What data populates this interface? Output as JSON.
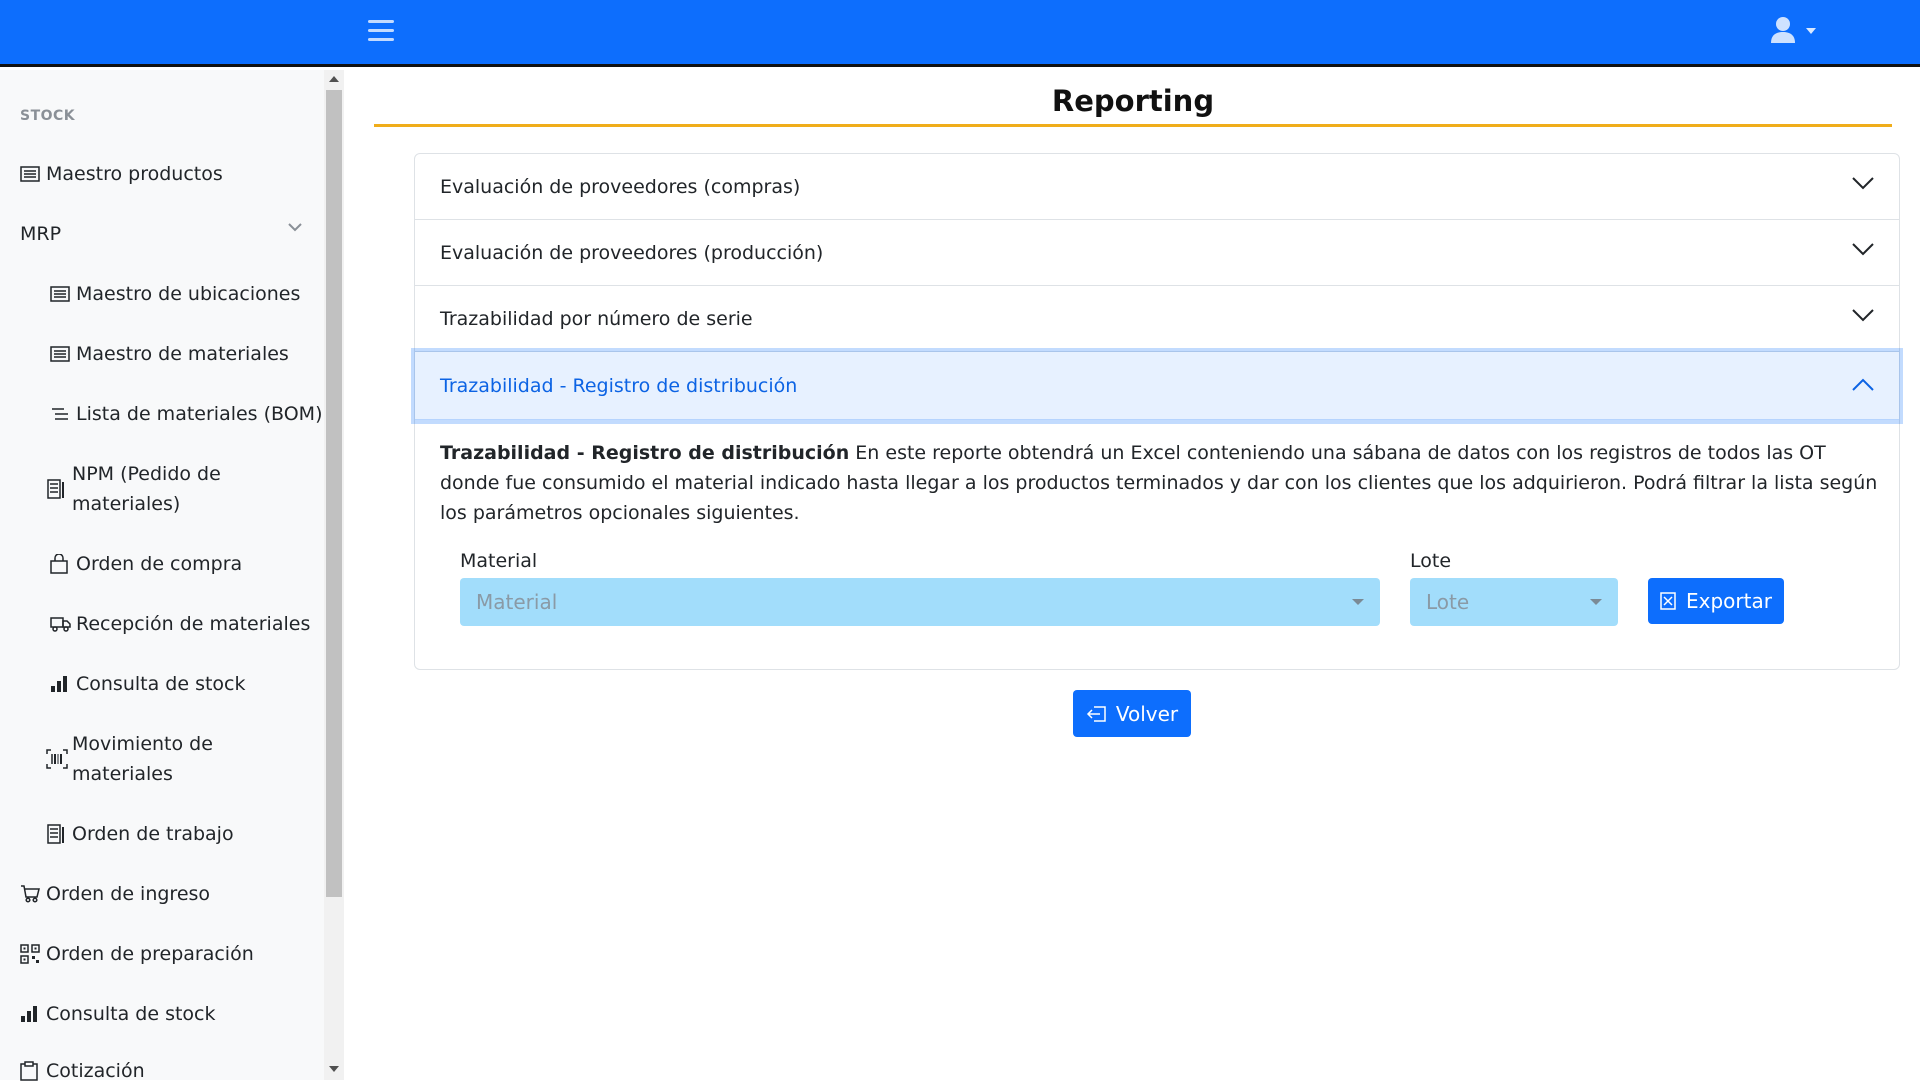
{
  "navbar": {
    "menu_icon": "hamburger-icon",
    "user_icon": "user-icon"
  },
  "sidebar": {
    "section_heading": "STOCK",
    "items": [
      {
        "label": "Maestro productos",
        "icon": "list-icon"
      },
      {
        "label": "MRP",
        "icon": "chevron-down-icon"
      },
      {
        "label": "Maestro de ubicaciones",
        "icon": "list-icon"
      },
      {
        "label": "Maestro de materiales",
        "icon": "list-icon"
      },
      {
        "label": "Lista de materiales (BOM)",
        "icon": "text-lines-icon"
      },
      {
        "label": "NPM (Pedido de materiales)",
        "icon": "document-icon"
      },
      {
        "label": "Orden de compra",
        "icon": "bag-icon"
      },
      {
        "label": "Recepción de materiales",
        "icon": "truck-icon"
      },
      {
        "label": "Consulta de stock",
        "icon": "bar-chart-icon"
      },
      {
        "label": "Movimiento de materiales",
        "icon": "barcode-icon"
      },
      {
        "label": "Orden de trabajo",
        "icon": "document-icon"
      },
      {
        "label": "Orden de ingreso",
        "icon": "cart-icon"
      },
      {
        "label": "Orden de preparación",
        "icon": "qr-icon"
      },
      {
        "label": "Consulta de stock",
        "icon": "bar-chart-icon"
      },
      {
        "label": "Cotización",
        "icon": "clipboard-icon"
      }
    ]
  },
  "main": {
    "title": "Reporting",
    "accordion": [
      {
        "label": "Evaluación de proveedores (compras)",
        "expanded": false
      },
      {
        "label": "Evaluación de proveedores (producción)",
        "expanded": false
      },
      {
        "label": "Trazabilidad por número de serie",
        "expanded": false
      },
      {
        "label": "Trazabilidad - Registro de distribución",
        "expanded": true
      }
    ],
    "body": {
      "bold": "Trazabilidad - Registro de distribución",
      "text": " En este reporte obtendrá un Excel conteniendo una sábana de datos con los registros de todos las OT donde fue consumido el material indicado hasta llegar a los productos terminados y dar con los clientes que los adquirieron. Podrá filtrar la lista según los parámetros opcionales siguientes."
    },
    "form": {
      "material_label": "Material",
      "material_placeholder": "Material",
      "lote_label": "Lote",
      "lote_placeholder": "Lote",
      "export_label": "Exportar",
      "export_icon": "excel-icon"
    },
    "back_label": "Volver",
    "back_icon": "back-arrow-icon"
  },
  "colors": {
    "primary": "#0d6efd",
    "title_rule": "#f0ad1a",
    "select_bg": "#a2ddfb"
  }
}
